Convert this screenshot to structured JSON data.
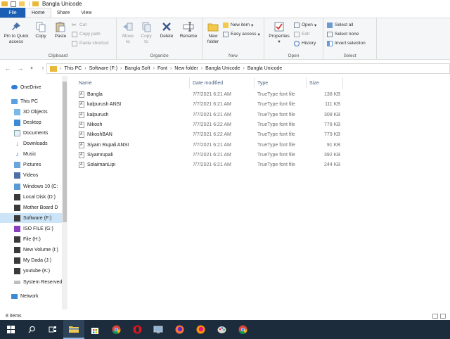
{
  "window": {
    "title": "Bangla Unicode"
  },
  "tabs": [
    {
      "label": "File"
    },
    {
      "label": "Home"
    },
    {
      "label": "Share"
    },
    {
      "label": "View"
    }
  ],
  "ribbon": {
    "clipboard": {
      "label": "Clipboard",
      "pin": "Pin to Quick access",
      "copy": "Copy",
      "paste": "Paste",
      "cut": "Cut",
      "copy_path": "Copy path",
      "paste_shortcut": "Paste shortcut"
    },
    "organize": {
      "label": "Organize",
      "move_to": "Move to",
      "copy_to": "Copy to",
      "delete": "Delete",
      "rename": "Rename"
    },
    "new": {
      "label": "New",
      "new_folder": "New folder",
      "new_item": "New item",
      "easy_access": "Easy access"
    },
    "open": {
      "label": "Open",
      "properties": "Properties",
      "open": "Open",
      "edit": "Edit",
      "history": "History"
    },
    "select": {
      "label": "Select",
      "select_all": "Select all",
      "select_none": "Select none",
      "invert": "Invert selection"
    }
  },
  "address": {
    "crumbs": [
      "This PC",
      "Software (F:)",
      "Bangla Soft",
      "Font",
      "New folder",
      "Bangla Unicode",
      "Bangla Unicode"
    ]
  },
  "nav_pane": {
    "items": [
      {
        "label": "OneDrive",
        "icon": "cloud-icon"
      },
      {
        "label": "This PC",
        "icon": "computer-icon"
      },
      {
        "label": "3D Objects",
        "icon": "cube-icon"
      },
      {
        "label": "Desktop",
        "icon": "desktop-icon"
      },
      {
        "label": "Documents",
        "icon": "documents-icon"
      },
      {
        "label": "Downloads",
        "icon": "download-icon"
      },
      {
        "label": "Music",
        "icon": "music-icon"
      },
      {
        "label": "Pictures",
        "icon": "pictures-icon"
      },
      {
        "label": "Videos",
        "icon": "videos-icon"
      },
      {
        "label": "Windows 10 (C:",
        "icon": "drive-icon"
      },
      {
        "label": "Local Disk (D:)",
        "icon": "drive-icon"
      },
      {
        "label": "Mother Board D",
        "icon": "drive-icon"
      },
      {
        "label": "Software (F:)",
        "icon": "drive-icon"
      },
      {
        "label": "ISO FILE (G:)",
        "icon": "drive-icon"
      },
      {
        "label": "File (H:)",
        "icon": "drive-icon"
      },
      {
        "label": "New Volume (I:)",
        "icon": "drive-icon"
      },
      {
        "label": "My Dada (J:)",
        "icon": "drive-icon"
      },
      {
        "label": "youtube (K:)",
        "icon": "drive-icon"
      },
      {
        "label": "System Reserved",
        "icon": "drive-icon"
      },
      {
        "label": "Network",
        "icon": "network-icon"
      }
    ]
  },
  "file_list": {
    "columns": {
      "name": "Name",
      "date": "Date modified",
      "type": "Type",
      "size": "Size"
    },
    "rows": [
      {
        "name": "Bangla",
        "date": "7/7/2021 6:21 AM",
        "type": "TrueType font file",
        "size": "138 KB"
      },
      {
        "name": "kalpurush ANSI",
        "date": "7/7/2021 6:21 AM",
        "type": "TrueType font file",
        "size": "111 KB"
      },
      {
        "name": "kalpurush",
        "date": "7/7/2021 6:21 AM",
        "type": "TrueType font file",
        "size": "308 KB"
      },
      {
        "name": "Nikosh",
        "date": "7/7/2021 6:22 AM",
        "type": "TrueType font file",
        "size": "778 KB"
      },
      {
        "name": "NikoshBAN",
        "date": "7/7/2021 6:22 AM",
        "type": "TrueType font file",
        "size": "779 KB"
      },
      {
        "name": "Siyam Rupali ANSI",
        "date": "7/7/2021 6:21 AM",
        "type": "TrueType font file",
        "size": "91 KB"
      },
      {
        "name": "Siyamrupali",
        "date": "7/7/2021 6:21 AM",
        "type": "TrueType font file",
        "size": "392 KB"
      },
      {
        "name": "SolaimanLipi",
        "date": "7/7/2021 6:21 AM",
        "type": "TrueType font file",
        "size": "244 KB"
      }
    ]
  },
  "status": {
    "count": "8 items"
  },
  "taskbar": {
    "items": [
      "windows-start-icon",
      "search-icon",
      "task-view-icon",
      "file-explorer-icon",
      "store-icon",
      "chrome-icon",
      "opera-icon",
      "computer-icon",
      "firefox-icon",
      "firefox-icon",
      "paint-icon",
      "chrome-icon"
    ]
  },
  "colors": {
    "accent": "#1a5fb4",
    "selected": "#cce4f7",
    "folder": "#e8b938",
    "taskbar": "#1c2c3c"
  }
}
